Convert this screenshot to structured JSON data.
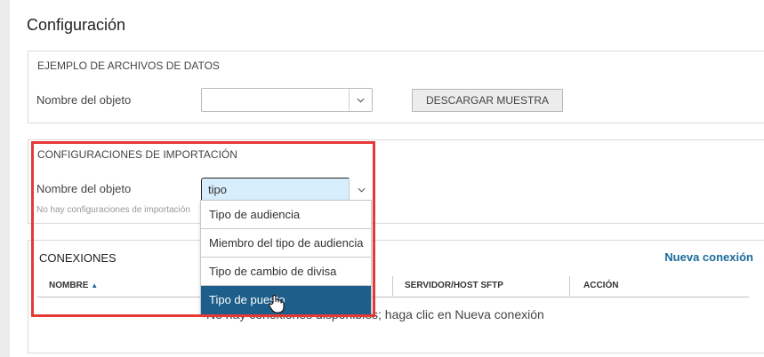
{
  "page": {
    "title": "Configuración"
  },
  "sample_panel": {
    "heading": "EJEMPLO DE ARCHIVOS DE DATOS",
    "object_label": "Nombre del objeto",
    "object_value": "",
    "download_button": "DESCARGAR MUESTRA"
  },
  "import_panel": {
    "heading": "CONFIGURACIONES DE IMPORTACIÓN",
    "object_label": "Nombre del objeto",
    "object_input_value": "tipo",
    "hint": "No hay configuraciones de importación"
  },
  "dropdown": {
    "options": [
      {
        "label": "Tipo de audiencia"
      },
      {
        "label": "Miembro del tipo de audiencia"
      },
      {
        "label": "Tipo de cambio de divisa"
      },
      {
        "label": "Tipo de puesto"
      }
    ],
    "selected_index": 3
  },
  "connections": {
    "title": "CONEXIONES",
    "new_link": "Nueva conexión",
    "columns": [
      "NOMBRE",
      "SERVIDOR/HOST SFTP",
      "ACCIÓN"
    ],
    "sort_indicator": "▲",
    "empty_message": "No hay conexiones disponibles; haga clic en Nueva conexión"
  },
  "colors": {
    "accent": "#1a6a99",
    "selected_option": "#1d5e8a",
    "highlight": "#e53935",
    "active_input": "#d7eefc"
  }
}
